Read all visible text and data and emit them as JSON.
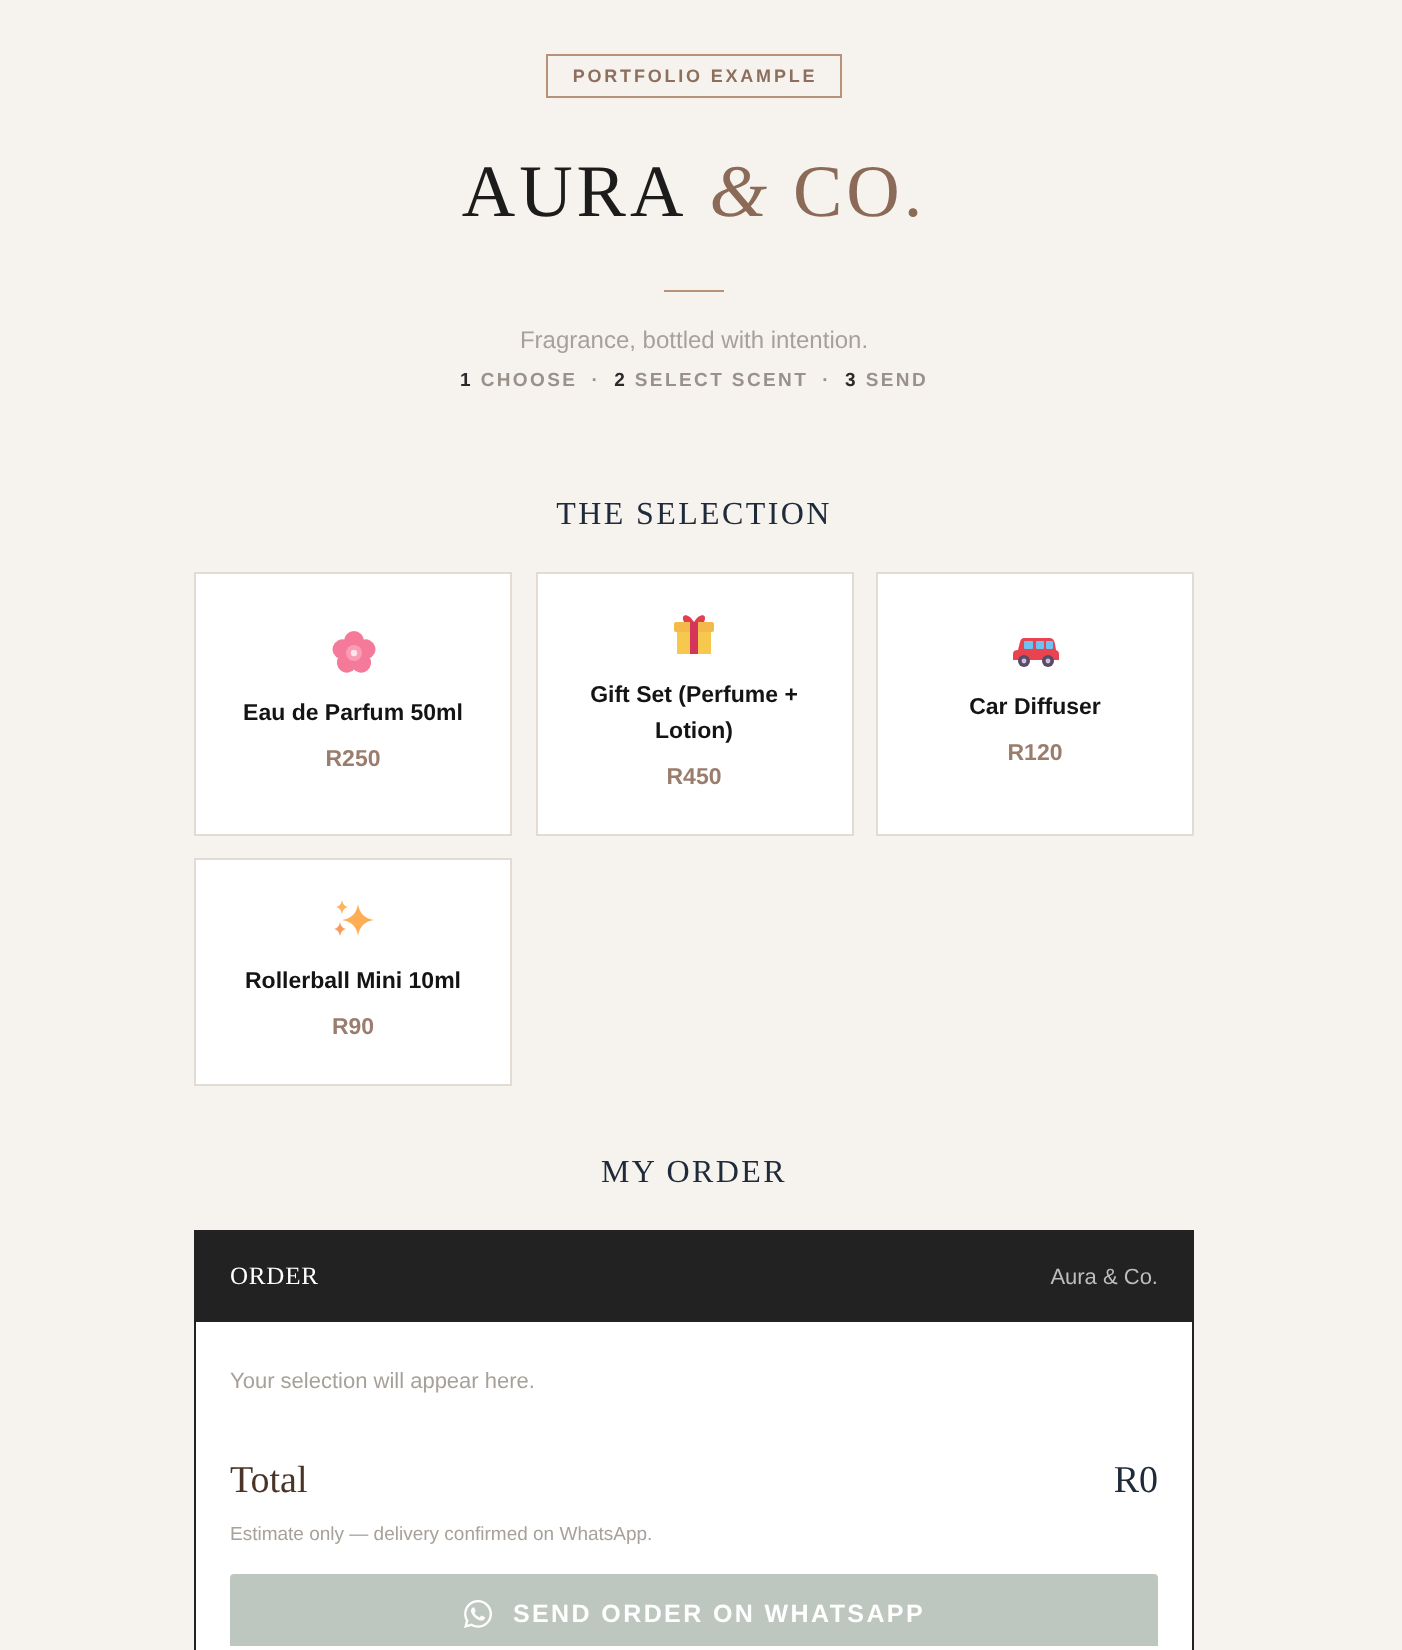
{
  "badge": "PORTFOLIO EXAMPLE",
  "title": [
    {
      "kind": "plain",
      "text": "AURA"
    },
    {
      "kind": "script",
      "text": "&"
    },
    {
      "kind": "accent",
      "text": "CO."
    }
  ],
  "tagline": "Fragrance, bottled with intention.",
  "steps": [
    {
      "kind": "step",
      "number": "1",
      "label": "CHOOSE"
    },
    {
      "kind": "separator",
      "text": "·"
    },
    {
      "kind": "step",
      "number": "2",
      "label": "SELECT SCENT"
    },
    {
      "kind": "separator",
      "text": "·"
    },
    {
      "kind": "step",
      "number": "3",
      "label": "SEND"
    }
  ],
  "selection": {
    "heading": "THE SELECTION",
    "products": [
      {
        "kind": "flower",
        "name": "Eau de Parfum 50ml",
        "price": "R250"
      },
      {
        "kind": "gift",
        "name": "Gift Set (Perfume + Lotion)",
        "price": "R450"
      },
      {
        "kind": "car",
        "name": "Car Diffuser",
        "price": "R120"
      },
      {
        "kind": "sparkles",
        "name": "Rollerball Mini 10ml",
        "price": "R90"
      }
    ]
  },
  "order": {
    "heading": "MY ORDER",
    "panel_title": "ORDER",
    "brand": "Aura & Co.",
    "empty_message": "Your selection will appear here.",
    "total_label": "Total",
    "total_value": "R0",
    "note": "Estimate only — delivery confirmed on WhatsApp.",
    "send_button": {
      "label": "SEND ORDER ON WHATSAPP",
      "disabled": true
    }
  }
}
